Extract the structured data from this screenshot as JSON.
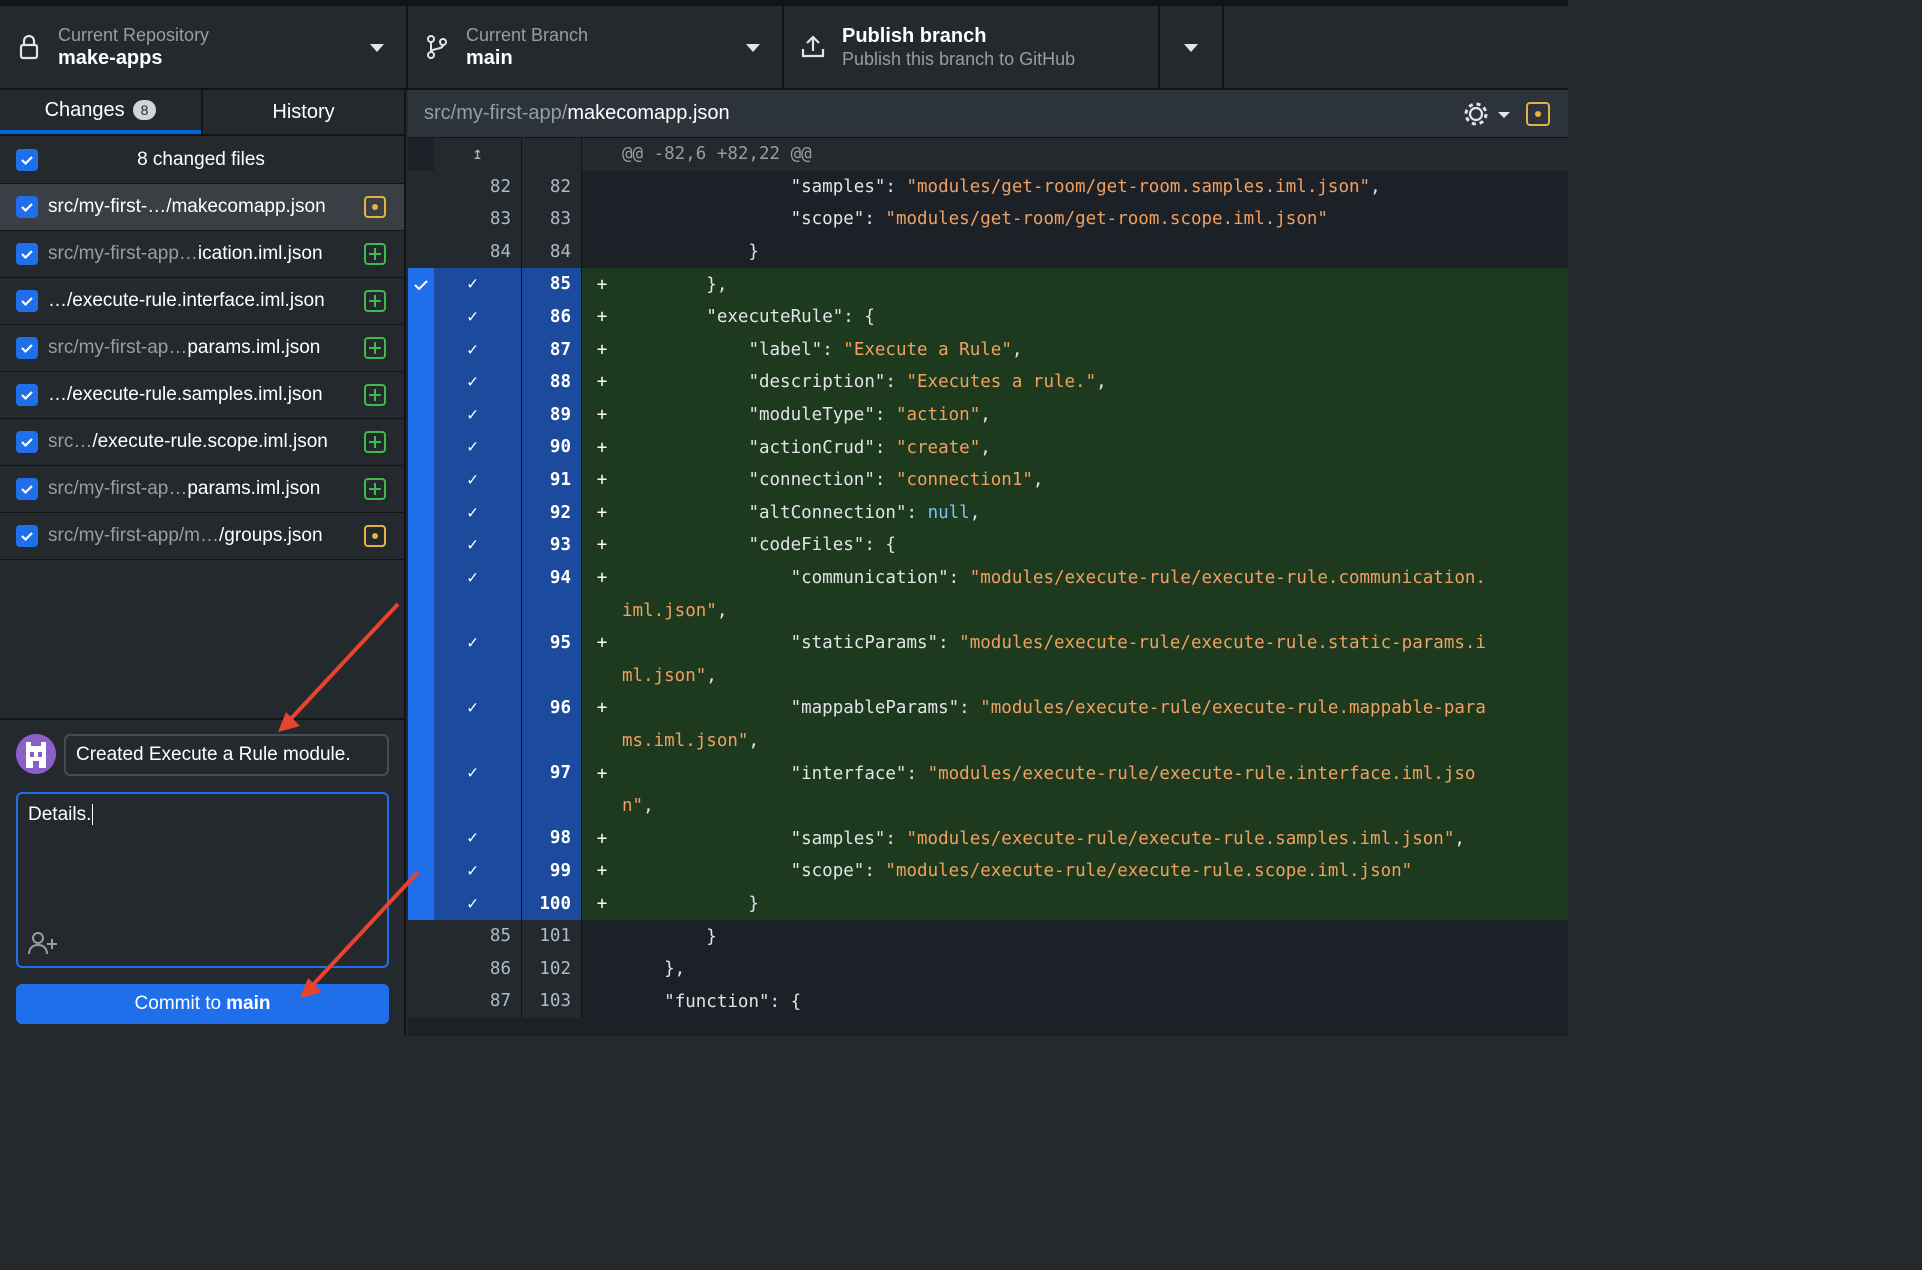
{
  "topbar": {
    "repo_label": "Current Repository",
    "repo_name": "make-apps",
    "branch_label": "Current Branch",
    "branch_name": "main",
    "publish_title": "Publish branch",
    "publish_subtitle": "Publish this branch to GitHub"
  },
  "tabs": {
    "changes_label": "Changes",
    "changes_count": "8",
    "history_label": "History"
  },
  "files": {
    "header": "8 changed files",
    "items": [
      {
        "dim": "",
        "name": "src/my-first-…/makecomapp.json",
        "status": "modified"
      },
      {
        "dim": "src/my-first-app…",
        "name": "ication.iml.json",
        "status": "added"
      },
      {
        "dim": "",
        "name": "…/execute-rule.interface.iml.json",
        "status": "added"
      },
      {
        "dim": "src/my-first-ap…",
        "name": "params.iml.json",
        "status": "added"
      },
      {
        "dim": "",
        "name": "…/execute-rule.samples.iml.json",
        "status": "added"
      },
      {
        "dim": "src…",
        "name": "/execute-rule.scope.iml.json",
        "status": "added"
      },
      {
        "dim": "src/my-first-ap…",
        "name": "params.iml.json",
        "status": "added"
      },
      {
        "dim": "src/my-first-app/m…",
        "name": "/groups.json",
        "status": "modified"
      }
    ]
  },
  "commit": {
    "summary": "Created Execute a Rule module.",
    "description": "Details.",
    "button_prefix": "Commit to",
    "button_branch": "main"
  },
  "diff": {
    "path_dir": "src/my-first-app/",
    "path_file": "makecomapp.json",
    "hunk": "@@ -82,6 +82,22 @@"
  },
  "colors": {
    "accent": "#1f6feb",
    "added": "#3fb950",
    "modified": "#e3b341",
    "string": "#f0a060",
    "null": "#79c0ff",
    "annotation_arrow": "#e8432e"
  }
}
